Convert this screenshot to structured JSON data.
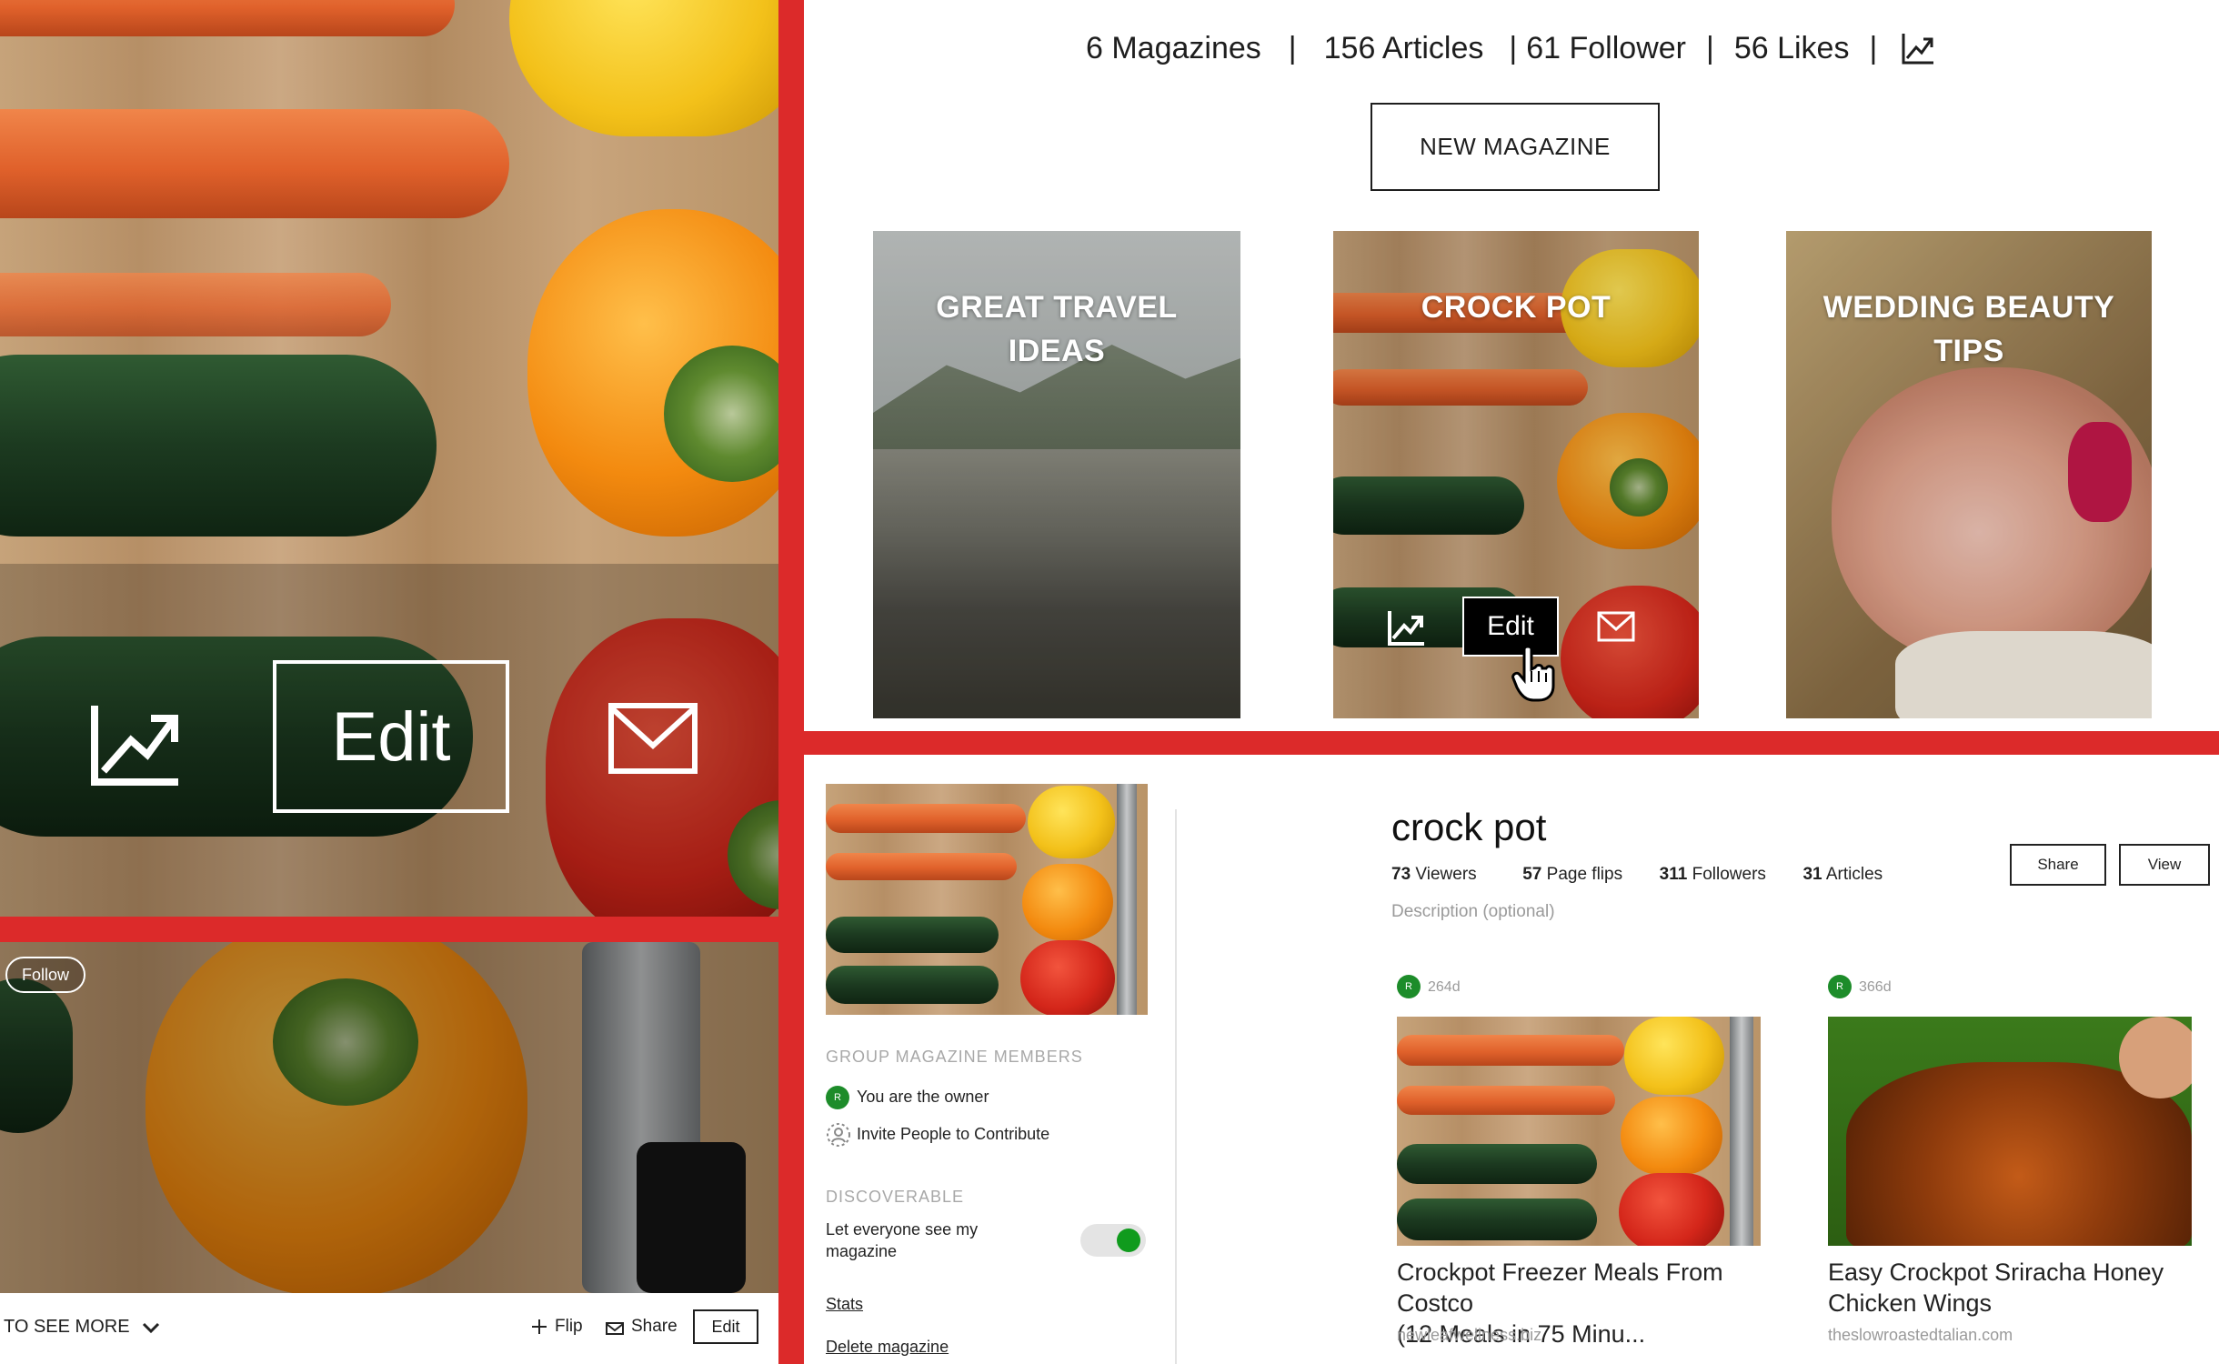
{
  "header": {
    "stats": [
      {
        "label": "6 Magazines"
      },
      {
        "label": "156 Articles"
      },
      {
        "label": "61 Follower"
      },
      {
        "label": "56 Likes"
      }
    ],
    "separator": "|",
    "stats_icon": "trending-up-icon",
    "new_magazine_label": "NEW MAGAZINE"
  },
  "magazines": [
    {
      "title_line1": "GREAT TRAVEL",
      "title_line2": "IDEAS"
    },
    {
      "title_line1": "CROCK POT",
      "title_line2": "",
      "hover_edit_label": "Edit"
    },
    {
      "title_line1": "WEDDING BEAUTY",
      "title_line2": "TIPS"
    }
  ],
  "left_panel": {
    "edit_label": "Edit",
    "stats_icon": "trending-up-icon",
    "mail_icon": "mail-icon"
  },
  "bottom_left": {
    "follow_label": "Follow",
    "see_more_label": "TO SEE MORE",
    "flip_label": "Flip",
    "share_label": "Share",
    "edit_label": "Edit"
  },
  "detail": {
    "sidebar": {
      "members_heading": "GROUP MAGAZINE MEMBERS",
      "owner_initial": "R",
      "owner_text": "You are the owner",
      "invite_text": "Invite People to Contribute",
      "discoverable_heading": "DISCOVERABLE",
      "discoverable_line1": "Let everyone see my",
      "discoverable_line2": "magazine",
      "discoverable_on": true,
      "stats_link": "Stats",
      "delete_link": "Delete magazine"
    },
    "title": "crock pot",
    "meta": {
      "viewers_n": "73",
      "viewers_l": "Viewers",
      "flips_n": "57",
      "flips_l": "Page flips",
      "followers_n": "311",
      "followers_l": "Followers",
      "articles_n": "31",
      "articles_l": "Articles"
    },
    "description_placeholder": "Description (optional)",
    "share_label": "Share",
    "view_label": "View",
    "articles": [
      {
        "initial": "R",
        "age": "264d",
        "title_line1": "Crockpot Freezer Meals From Costco",
        "title_line2": "(12 Meals in 75 Minu...",
        "source": "newleafwellness.biz"
      },
      {
        "initial": "R",
        "age": "366d",
        "title_line1": "Easy Crockpot Sriracha Honey",
        "title_line2": "Chicken Wings",
        "source": "theslowroastedtalian.com"
      }
    ]
  },
  "colors": {
    "accent_red": "#dc2a2a",
    "toggle_green": "#109b1d",
    "avatar_green": "#1d8c2a"
  }
}
